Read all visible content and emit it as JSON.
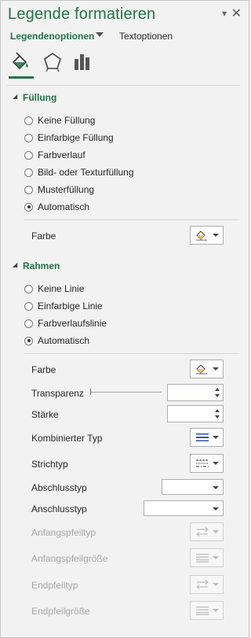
{
  "pane": {
    "title": "Legende formatieren",
    "close_glyph": "✕",
    "options_glyph": "▾"
  },
  "tabs": {
    "active_label": "Legendenoptionen",
    "other_label": "Textoptionen"
  },
  "icons": {
    "tab1": "paint-bucket-icon",
    "tab2": "pentagon-icon",
    "tab3": "bar-chart-icon"
  },
  "fill": {
    "heading": "Füllung",
    "options": [
      {
        "label": "Keine Füllung",
        "checked": false
      },
      {
        "label": "Einfarbige Füllung",
        "checked": false
      },
      {
        "label": "Farbverlauf",
        "checked": false
      },
      {
        "label": "Bild- oder Texturfüllung",
        "checked": false
      },
      {
        "label": "Musterfüllung",
        "checked": false
      },
      {
        "label": "Automatisch",
        "checked": true
      }
    ],
    "color_label": "Farbe"
  },
  "border": {
    "heading": "Rahmen",
    "options": [
      {
        "label": "Keine Linie",
        "checked": false
      },
      {
        "label": "Einfarbige Linie",
        "checked": false
      },
      {
        "label": "Farbverlaufslinie",
        "checked": false
      },
      {
        "label": "Automatisch",
        "checked": true
      }
    ],
    "color_label": "Farbe",
    "transparency_label": "Transparenz",
    "transparency_value": "",
    "width_label": "Stärke",
    "width_value": "",
    "compound_label": "Kombinierter Typ",
    "dash_label": "Strichtyp",
    "cap_label": "Abschlusstyp",
    "cap_value": "",
    "join_label": "Anschlusstyp",
    "join_value": "",
    "begin_arrow_type_label": "Anfangspfeiltyp",
    "begin_arrow_size_label": "Anfangspfeilgröße",
    "end_arrow_type_label": "Endpfeiltyp",
    "end_arrow_size_label": "Endpfeilgröße"
  }
}
